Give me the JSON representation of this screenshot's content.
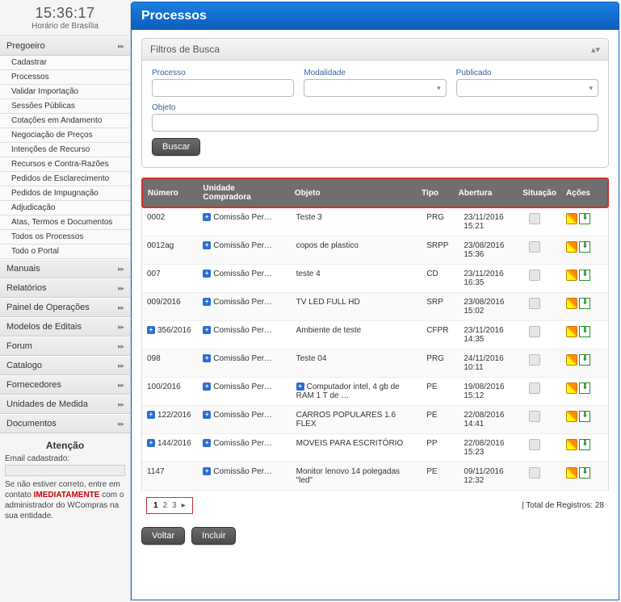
{
  "clock": {
    "time": "15:36:17",
    "label": "Horário de Brasília"
  },
  "sidebar": {
    "pregoeiro": {
      "title": "Pregoeiro",
      "items": [
        "Cadastrar",
        "Processos",
        "Validar Importação",
        "Sessões Públicas",
        "Cotações em Andamento",
        "Negociação de Preços",
        "Intenções de Recurso",
        "Recursos e Contra-Razões",
        "Pedidos de Esclarecimento",
        "Pedidos de Impugnação",
        "Adjudicação",
        "Atas, Termos e Documentos",
        "Todos os Processos",
        "Todo o Portal"
      ]
    },
    "sections": [
      "Manuais",
      "Relatórios",
      "Painel de Operações",
      "Modelos de Editais",
      "Forum",
      "Catalogo",
      "Fornecedores",
      "Unidades de Medida",
      "Documentos"
    ],
    "info": {
      "title": "Atenção",
      "email_label": "Email cadastrado:",
      "text_before": "Se não estiver correto, entre em contato ",
      "highlight": "IMEDIATAMENTE",
      "text_after": " com o administrador do WCompras na sua entidade."
    }
  },
  "page": {
    "title": "Processos",
    "filter": {
      "header": "Filtros de Busca",
      "processo_label": "Processo",
      "modalidade_label": "Modalidade",
      "publicado_label": "Publicado",
      "objeto_label": "Objeto",
      "buscar": "Buscar"
    },
    "table": {
      "headers": [
        "Número",
        "Unidade Compradora",
        "Objeto",
        "Tipo",
        "Abertura",
        "Situação",
        "Ações"
      ],
      "rows": [
        {
          "numero": "0002",
          "unidade": "Comissão Per…",
          "objeto": "Teste 3",
          "tipo": "PRG",
          "abertura": "23/11/2016 15:21",
          "obj_has_plus": false
        },
        {
          "numero": "0012ag",
          "unidade": "Comissão Per…",
          "objeto": "copos de plastico",
          "tipo": "SRPP",
          "abertura": "23/08/2016 15:36",
          "obj_has_plus": false
        },
        {
          "numero": "007",
          "unidade": "Comissão Per…",
          "objeto": "teste 4",
          "tipo": "CD",
          "abertura": "23/11/2016 16:35",
          "obj_has_plus": false
        },
        {
          "numero": "009/2016",
          "unidade": "Comissão Per…",
          "objeto": "TV LED FULL HD",
          "tipo": "SRP",
          "abertura": "23/08/2016 15:02",
          "obj_has_plus": false
        },
        {
          "numero": "356/2016",
          "unidade": "Comissão Per…",
          "objeto": "Ambiente de teste",
          "tipo": "CFPR",
          "abertura": "23/11/2016 14:35",
          "num_has_plus": true
        },
        {
          "numero": "098",
          "unidade": "Comissão Per…",
          "objeto": "Teste 04",
          "tipo": "PRG",
          "abertura": "24/11/2016 10:11",
          "obj_has_plus": false
        },
        {
          "numero": "100/2016",
          "unidade": "Comissão Per…",
          "objeto": "Computador intel, 4 gb de RAM 1 T de …",
          "tipo": "PE",
          "abertura": "19/08/2016 15:12",
          "obj_has_plus": true
        },
        {
          "numero": "122/2016",
          "unidade": "Comissão Per…",
          "objeto": "CARROS POPULARES 1.6 FLEX",
          "tipo": "PE",
          "abertura": "22/08/2016 14:41",
          "num_has_plus": true
        },
        {
          "numero": "144/2016",
          "unidade": "Comissão Per…",
          "objeto": "MOVEIS PARA ESCRITÓRIO",
          "tipo": "PP",
          "abertura": "22/08/2016 15:23",
          "num_has_plus": true
        },
        {
          "numero": "1147",
          "unidade": "Comissão Per…",
          "objeto": "Monitor lenovo 14 polegadas \"led\"",
          "tipo": "PE",
          "abertura": "09/11/2016 12:32",
          "obj_has_plus": false
        }
      ]
    },
    "pages": [
      "1",
      "2",
      "3"
    ],
    "total_label": "| Total de Registros: 28",
    "buttons": {
      "voltar": "Voltar",
      "incluir": "Incluir"
    }
  }
}
